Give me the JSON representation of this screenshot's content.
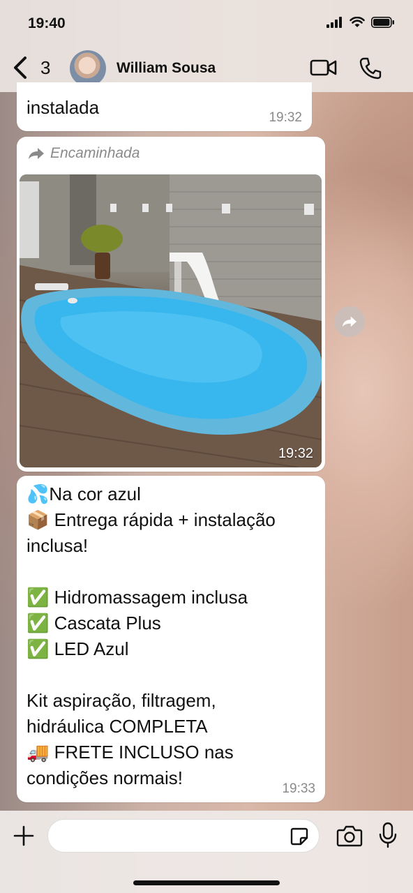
{
  "status_bar": {
    "time": "19:40"
  },
  "header": {
    "back_count": "3",
    "contact_name": "William Sousa"
  },
  "messages": [
    {
      "text": "instalada",
      "time": "19:32"
    },
    {
      "forwarded_label": "Encaminhada",
      "type": "image",
      "time": "19:32"
    },
    {
      "lines": [
        "💦Na cor azul",
        "📦 Entrega rápida + instalação",
        "inclusa!",
        "",
        "✅ Hidromassagem inclusa",
        "✅ Cascata Plus",
        "✅ LED Azul",
        "",
        "Kit aspiração, filtragem,",
        "hidráulica COMPLETA",
        "🚚 FRETE INCLUSO nas",
        "condições normais!"
      ],
      "time": "19:33"
    }
  ],
  "icons": {
    "back": "chevron-left-icon",
    "video": "video-camera-icon",
    "call": "phone-icon",
    "forward": "forward-arrow-icon",
    "share": "share-icon",
    "add": "plus-icon",
    "sticker": "sticker-icon",
    "camera": "camera-icon",
    "mic": "microphone-icon"
  },
  "colors": {
    "bubble": "#ffffff",
    "pool": "#4fb8e6",
    "timestamp": "#8a8a8a"
  }
}
